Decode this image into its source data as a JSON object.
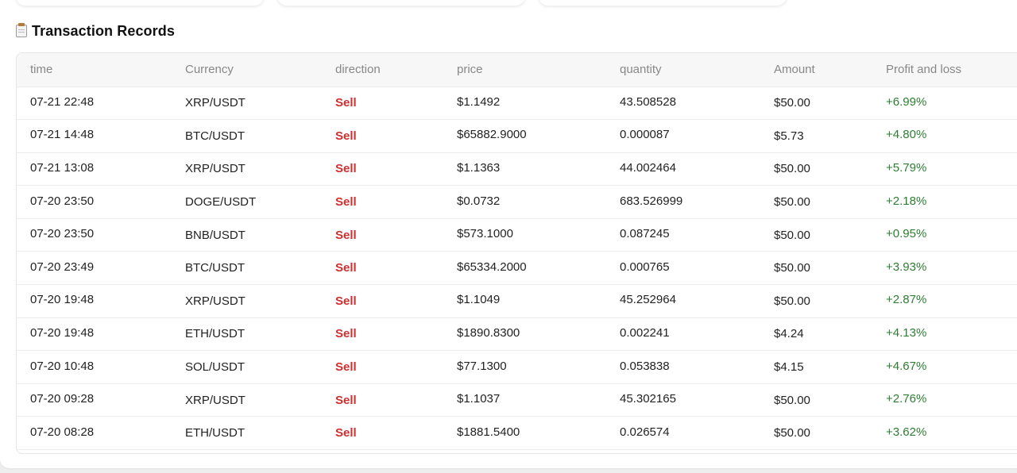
{
  "section": {
    "title": "Transaction Records",
    "icon": "clipboard-icon"
  },
  "colors": {
    "sell": "#d32f2f",
    "profit": "#2e7d32",
    "header_text": "#888888"
  },
  "table": {
    "columns": [
      "time",
      "Currency",
      "direction",
      "price",
      "quantity",
      "Amount",
      "Profit and loss"
    ],
    "rows": [
      {
        "time": "07-21 22:48",
        "currency": "XRP/USDT",
        "direction": "Sell",
        "price": "$1.1492",
        "quantity": "43.508528",
        "amount": "$50.00",
        "pl": "+6.99%"
      },
      {
        "time": "07-21 14:48",
        "currency": "BTC/USDT",
        "direction": "Sell",
        "price": "$65882.9000",
        "quantity": "0.000087",
        "amount": "$5.73",
        "pl": "+4.80%"
      },
      {
        "time": "07-21 13:08",
        "currency": "XRP/USDT",
        "direction": "Sell",
        "price": "$1.1363",
        "quantity": "44.002464",
        "amount": "$50.00",
        "pl": "+5.79%"
      },
      {
        "time": "07-20 23:50",
        "currency": "DOGE/USDT",
        "direction": "Sell",
        "price": "$0.0732",
        "quantity": "683.526999",
        "amount": "$50.00",
        "pl": "+2.18%"
      },
      {
        "time": "07-20 23:50",
        "currency": "BNB/USDT",
        "direction": "Sell",
        "price": "$573.1000",
        "quantity": "0.087245",
        "amount": "$50.00",
        "pl": "+0.95%"
      },
      {
        "time": "07-20 23:49",
        "currency": "BTC/USDT",
        "direction": "Sell",
        "price": "$65334.2000",
        "quantity": "0.000765",
        "amount": "$50.00",
        "pl": "+3.93%"
      },
      {
        "time": "07-20 19:48",
        "currency": "XRP/USDT",
        "direction": "Sell",
        "price": "$1.1049",
        "quantity": "45.252964",
        "amount": "$50.00",
        "pl": "+2.87%"
      },
      {
        "time": "07-20 19:48",
        "currency": "ETH/USDT",
        "direction": "Sell",
        "price": "$1890.8300",
        "quantity": "0.002241",
        "amount": "$4.24",
        "pl": "+4.13%"
      },
      {
        "time": "07-20 10:48",
        "currency": "SOL/USDT",
        "direction": "Sell",
        "price": "$77.1300",
        "quantity": "0.053838",
        "amount": "$4.15",
        "pl": "+4.67%"
      },
      {
        "time": "07-20 09:28",
        "currency": "XRP/USDT",
        "direction": "Sell",
        "price": "$1.1037",
        "quantity": "45.302165",
        "amount": "$50.00",
        "pl": "+2.76%"
      },
      {
        "time": "07-20 08:28",
        "currency": "ETH/USDT",
        "direction": "Sell",
        "price": "$1881.5400",
        "quantity": "0.026574",
        "amount": "$50.00",
        "pl": "+3.62%"
      }
    ]
  }
}
